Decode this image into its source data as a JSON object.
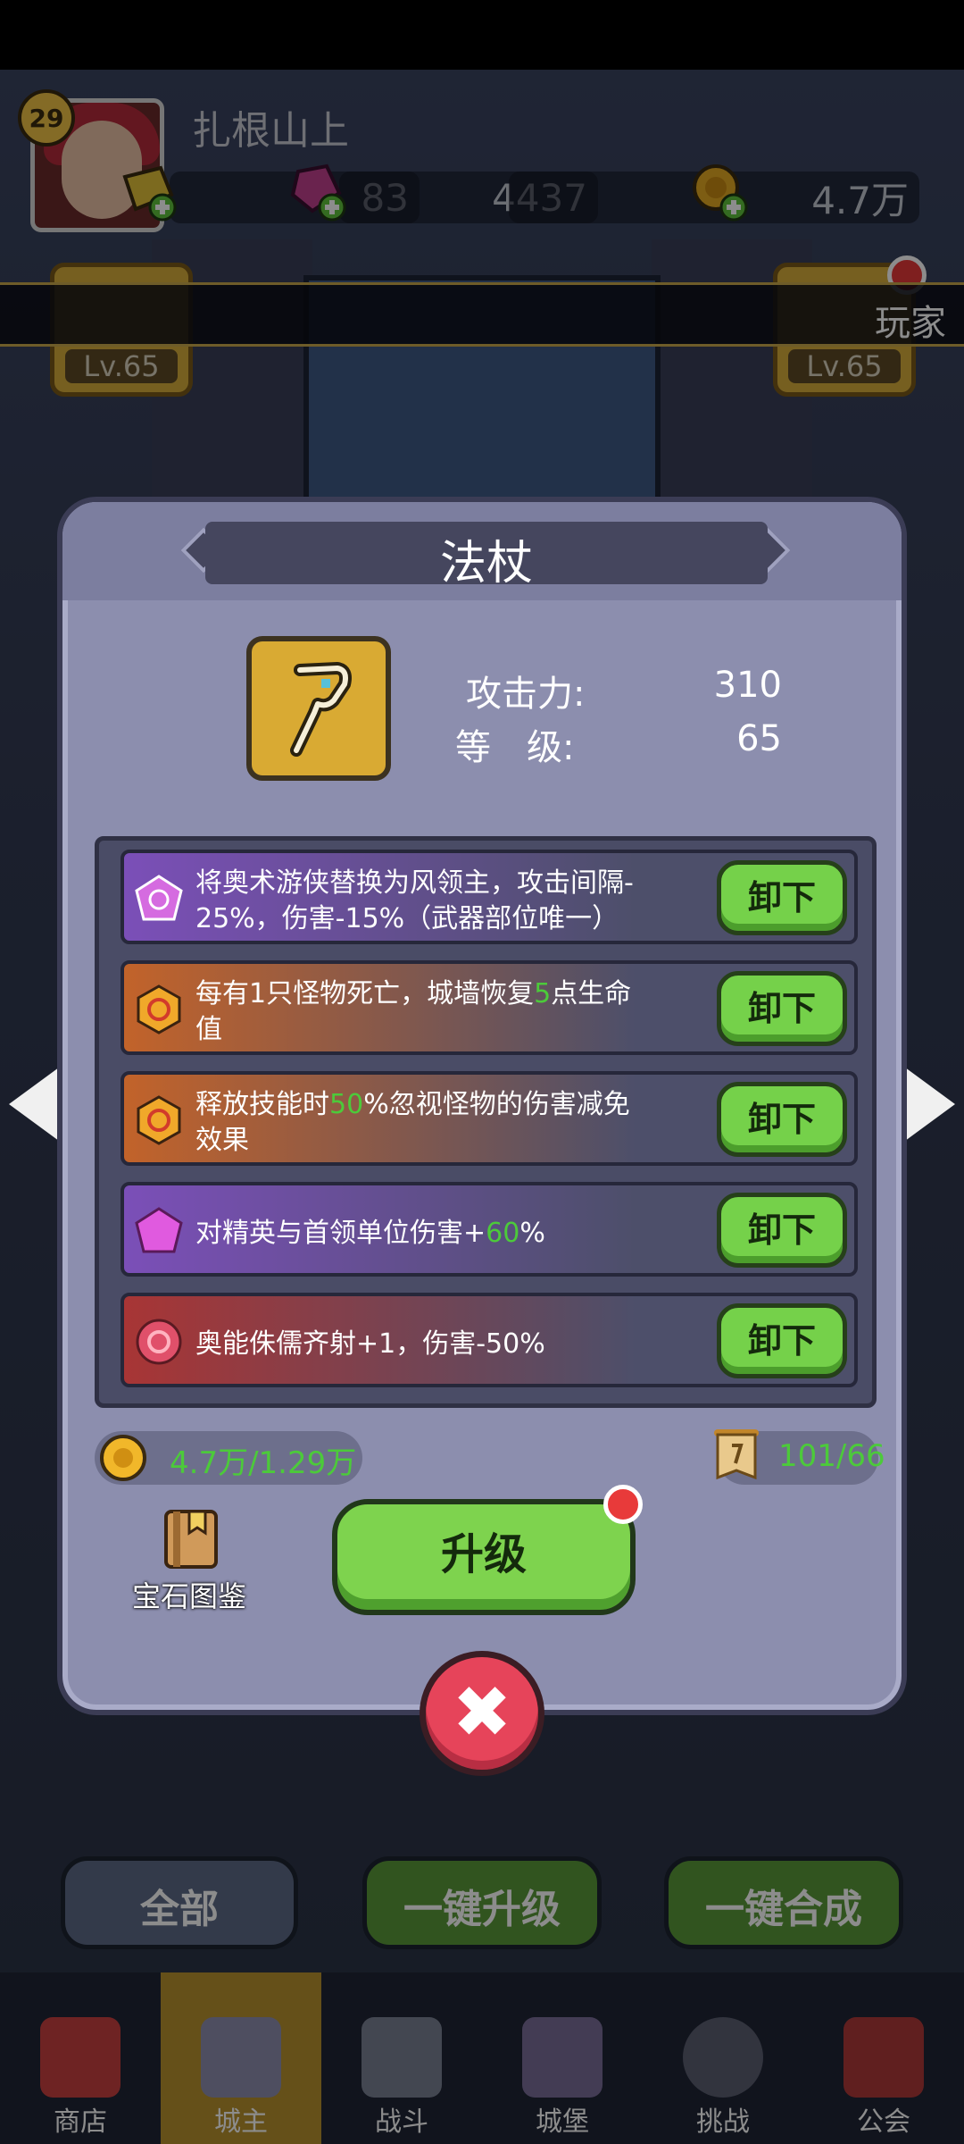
{
  "player": {
    "level": "29",
    "name": "扎根山上",
    "gold_bars": "83",
    "gems": "4437",
    "coins": "4.7万"
  },
  "banner_text": "玩家",
  "side_cards": {
    "left_level": "Lv.65",
    "right_level": "Lv.65"
  },
  "modal": {
    "title": "法杖",
    "attack_label": "攻击力:",
    "attack_value": "310",
    "level_label": "等　级:",
    "level_value": "65",
    "gems": [
      {
        "icon": "purple-pentagon-gem-icon",
        "color": "#7b4fb8",
        "line1": "将奥术游侠替换为风领主，攻击间隔-",
        "line2": "25%，伤害-15%（武器部位唯一）",
        "button": "卸下"
      },
      {
        "icon": "orange-hexagon-gem-icon",
        "color": "#c2632a",
        "prefix": "每有1只怪物死亡，城墙恢复",
        "highlight": "5",
        "suffix": "点生命",
        "line2": "值",
        "button": "卸下"
      },
      {
        "icon": "orange-hexagon-gem-icon",
        "color": "#c2632a",
        "prefix": "释放技能时",
        "highlight": "50",
        "suffix": "%忽视怪物的伤害减免",
        "line2": "效果",
        "button": "卸下"
      },
      {
        "icon": "purple-pentagon-gem-icon",
        "color": "#7b4fb8",
        "prefix": "对精英与首领单位伤害+",
        "highlight": "60",
        "suffix": "%",
        "button": "卸下"
      },
      {
        "icon": "red-round-gem-icon",
        "color": "#a83535",
        "text": "奥能侏儒齐射+1，伤害-50%",
        "button": "卸下"
      }
    ],
    "gold_cost": "4.7万/1.29万",
    "scroll_cost": "101/66",
    "atlas_label": "宝石图鉴",
    "upgrade_label": "升级",
    "close_symbol": "✖"
  },
  "bottom_actions": {
    "all": "全部",
    "one_click_upgrade": "一键升级",
    "one_click_merge": "一键合成"
  },
  "tabs": [
    {
      "label": "商店",
      "icon": "shop-icon"
    },
    {
      "label": "城主",
      "icon": "crown-icon",
      "active": true
    },
    {
      "label": "战斗",
      "icon": "swords-icon"
    },
    {
      "label": "城堡",
      "icon": "castle-icon"
    },
    {
      "label": "挑战",
      "icon": "monster-icon"
    },
    {
      "label": "公会",
      "icon": "guild-icon"
    }
  ],
  "colors": {
    "modal_bg": "#8c8eae",
    "accent_green": "#75d14a",
    "highlight_green": "#4cca3a",
    "close_red": "#e6445a",
    "gold": "#d9aa33"
  }
}
